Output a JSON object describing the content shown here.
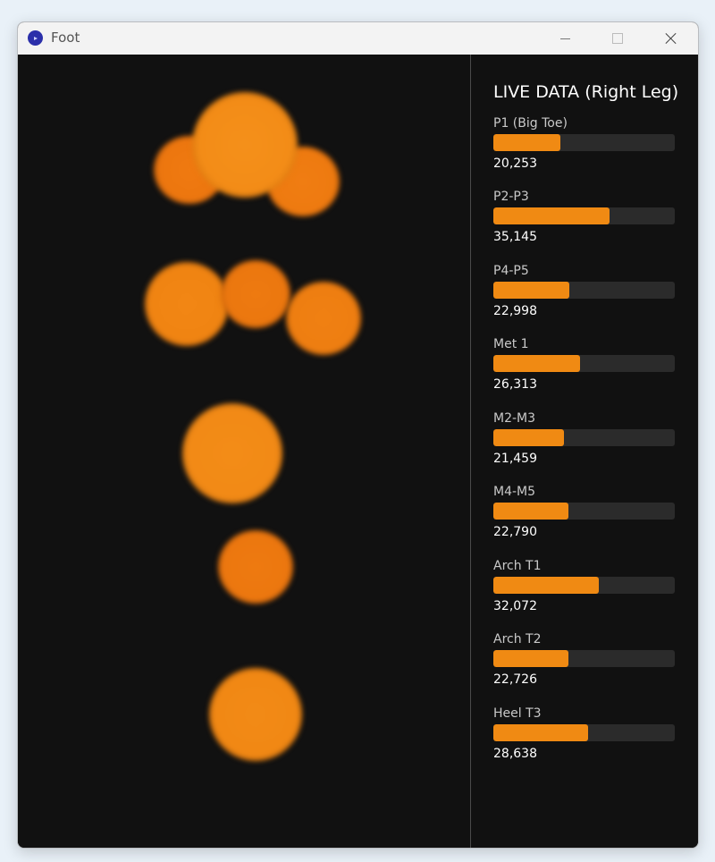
{
  "window": {
    "title": "Foot",
    "app_icon": "app-logo-icon",
    "controls": [
      "minimize-icon",
      "maximize-icon",
      "close-icon"
    ]
  },
  "colors": {
    "accent": "#f08a13",
    "background": "#111111",
    "bar_track": "#2b2b2b"
  },
  "panel": {
    "title": "LIVE DATA (Right Leg)",
    "bar_max": 55000,
    "sensors": [
      {
        "label": "P1 (Big Toe)",
        "value": "20,253",
        "level": 20253
      },
      {
        "label": "P2-P3",
        "value": "35,145",
        "level": 35145
      },
      {
        "label": "P4-P5",
        "value": "22,998",
        "level": 22998
      },
      {
        "label": "Met 1",
        "value": "26,313",
        "level": 26313
      },
      {
        "label": "M2-M3",
        "value": "21,459",
        "level": 21459
      },
      {
        "label": "M4-M5",
        "value": "22,790",
        "level": 22790
      },
      {
        "label": "Arch T1",
        "value": "32,072",
        "level": 32072
      },
      {
        "label": "Arch T2",
        "value": "22,726",
        "level": 22726
      },
      {
        "label": "Heel T3",
        "value": "28,638",
        "level": 28638
      }
    ]
  }
}
